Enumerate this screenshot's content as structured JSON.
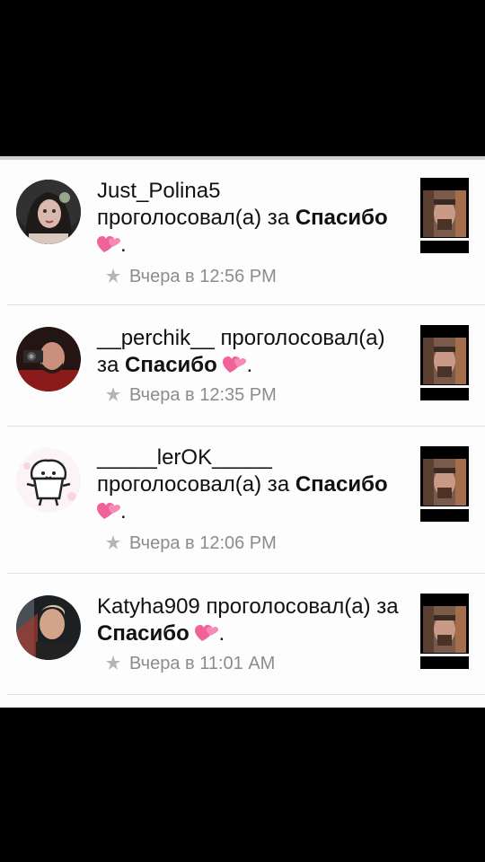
{
  "notifications": [
    {
      "username": "Just_Polina5",
      "action": "проголосовал(а) за",
      "target": "Спасибо",
      "end": ".",
      "time": "Вчера в 12:56 PM",
      "avatar_icon": "girl-portrait-avatar"
    },
    {
      "username": "__perchik__",
      "action": "проголосовал(а) за",
      "target": "Спасибо",
      "end": ".",
      "time": "Вчера в 12:35 PM",
      "avatar_icon": "man-with-camera-avatar"
    },
    {
      "username": "_____lerOK_____",
      "action": "проголосовал(а) за",
      "target": "Спасибо",
      "end": ".",
      "time": "Вчера в 12:06 PM",
      "avatar_icon": "muffin-cartoon-avatar"
    },
    {
      "username": "Katyha909",
      "action": "проголосовал(а) за",
      "target": "Спасибо",
      "end": ".",
      "time": "Вчера в 11:01 AM",
      "avatar_icon": "man-portrait-avatar"
    }
  ],
  "colors": {
    "background": "#fdfdfd",
    "letterbox": "#000000",
    "text": "#111111",
    "time": "#8c8c8c",
    "heart": "#f0629a",
    "divider": "#e2e2e2"
  }
}
